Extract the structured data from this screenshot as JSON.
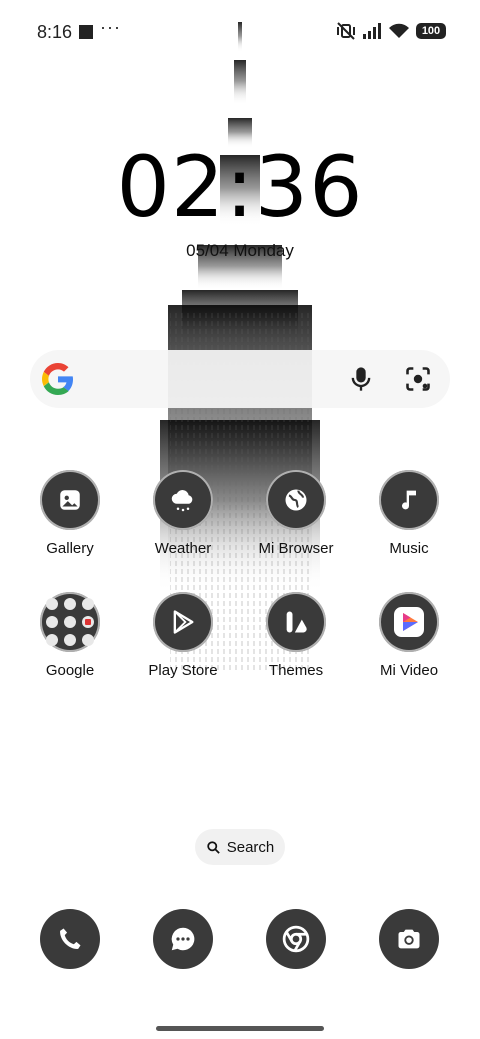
{
  "status_bar": {
    "time": "8:16",
    "dots": "···",
    "battery": "100"
  },
  "clock": {
    "time": "02:36",
    "date": "05/04 Monday"
  },
  "google_search": {
    "brand_colors": [
      "#4285F4",
      "#EA4335",
      "#FBBC05",
      "#34A853"
    ]
  },
  "apps": [
    {
      "label": "Gallery",
      "icon": "gallery-icon"
    },
    {
      "label": "Weather",
      "icon": "weather-icon"
    },
    {
      "label": "Mi Browser",
      "icon": "globe-icon"
    },
    {
      "label": "Music",
      "icon": "music-note-icon"
    },
    {
      "label": "Google",
      "icon": "folder-icon"
    },
    {
      "label": "Play Store",
      "icon": "play-store-icon"
    },
    {
      "label": "Themes",
      "icon": "themes-icon"
    },
    {
      "label": "Mi Video",
      "icon": "mi-video-icon"
    }
  ],
  "search_pill": {
    "label": "Search"
  },
  "dock": [
    {
      "icon": "phone-icon"
    },
    {
      "icon": "messages-icon"
    },
    {
      "icon": "chrome-icon"
    },
    {
      "icon": "camera-icon"
    }
  ],
  "colors": {
    "icon_bg": "#3a3a3a",
    "background": "#ffffff"
  }
}
